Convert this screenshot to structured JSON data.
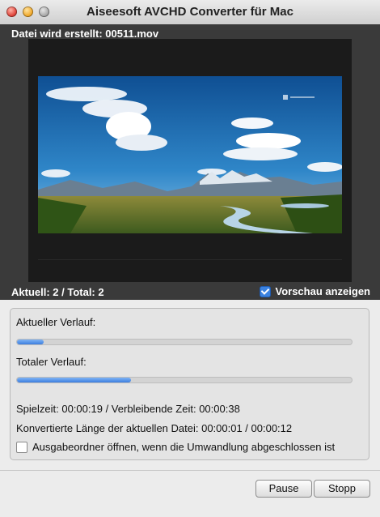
{
  "window": {
    "title": "Aiseesoft AVCHD Converter für Mac"
  },
  "preview": {
    "creating_file": "Datei wird erstellt: 00511.mov",
    "counts": "Aktuell: 2 / Total: 2",
    "show_preview_label": "Vorschau anzeigen",
    "show_preview_checked": true
  },
  "progress": {
    "current_label": "Aktueller Verlauf:",
    "current_fraction": 0.08,
    "total_label": "Totaler Verlauf:",
    "total_fraction": 0.34,
    "playtime": "Spielzeit: 00:00:19 / Verbleibende Zeit: 00:00:38",
    "converted_length": "Konvertierte Länge der aktuellen Datei: 00:00:01 / 00:00:12",
    "open_folder_label": "Ausgabeordner öffnen, wenn die Umwandlung abgeschlossen ist",
    "open_folder_checked": false
  },
  "buttons": {
    "pause": "Pause",
    "stop": "Stopp"
  },
  "colors": {
    "accent": "#3b7ede"
  }
}
